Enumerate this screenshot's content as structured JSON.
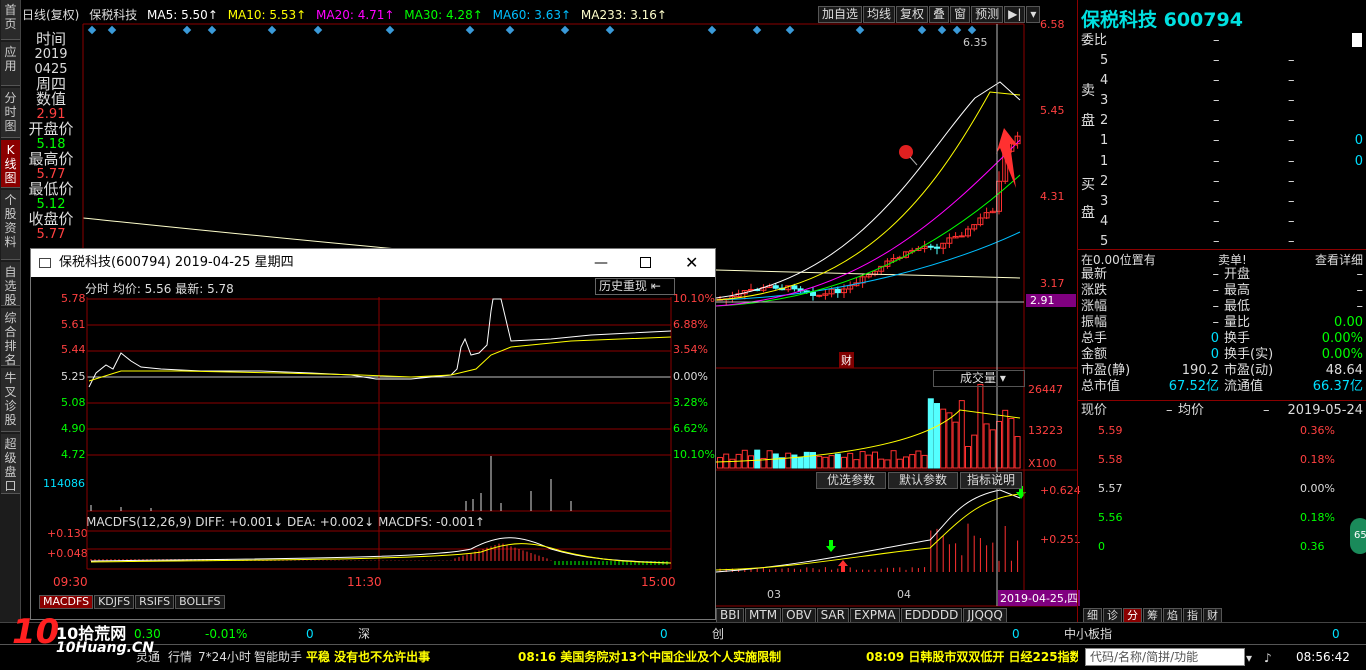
{
  "vtabs": [
    "首页",
    "应用",
    "分时图",
    "K线图",
    "个股资料",
    "自选股",
    "综合排名",
    "牛叉诊股",
    "超级盘口"
  ],
  "topbar": {
    "period": "日线(复权)",
    "stock": "保税科技",
    "ma5": "MA5: 5.50↑",
    "ma10": "MA10: 5.53↑",
    "ma20": "MA20: 4.71↑",
    "ma30": "MA30: 4.28↑",
    "ma60": "MA60: 3.63↑",
    "ma233": "MA233: 3.16↑"
  },
  "ctrl": [
    "加自选",
    "均线",
    "复权",
    "叠",
    "窗",
    "预测"
  ],
  "info": {
    "l1": "时间",
    "l2": "2019",
    "l3": "0425",
    "l4": "周四",
    "l5": "数值",
    "v5": "2.91",
    "l6": "开盘价",
    "v6": "5.18",
    "l7": "最高价",
    "v7": "5.77",
    "l8": "最低价",
    "v8": "5.12",
    "l9": "收盘价",
    "v9": "5.77"
  },
  "prices": {
    "p1": "6.58",
    "p2": "5.45",
    "p3": "4.31",
    "p4": "3.17",
    "p5": "2.91",
    "hi": "6.35"
  },
  "vol": {
    "label": "成交量",
    "v1": "26447",
    "v2": "13223",
    "v3": "X100"
  },
  "params": [
    "优选参数",
    "默认参数",
    "指标说明"
  ],
  "macd": {
    "m1": "0.624",
    "m2": "0.251"
  },
  "months": {
    "m3": "03",
    "m4": "04",
    "date": "2019-04-25,四",
    "cai": "财"
  },
  "itabs": [
    "BBI",
    "MTM",
    "OBV",
    "SAR",
    "EXPMA",
    "EDDDDD",
    "JJQQQ"
  ],
  "rp": {
    "title": "保税科技 600794",
    "weibi": "委比",
    "dash": "–",
    "mai": "卖",
    "pan": "盘",
    "buy": "买",
    "zero": "0",
    "atzero": "在0.00位置有",
    "maidan": "卖单!",
    "detail": "查看详细",
    "s": [
      "5",
      "4",
      "3",
      "2",
      "1"
    ],
    "b": [
      "1",
      "2",
      "3",
      "4",
      "5"
    ],
    "k1": "最新",
    "k2": "开盘",
    "k3": "涨跌",
    "k4": "最高",
    "k5": "涨幅",
    "k6": "最低",
    "k7": "振幅",
    "k8": "量比",
    "k9": "总手",
    "k10": "换手",
    "k11": "金额",
    "k12": "换手(实)",
    "k13": "市盈(静)",
    "k14": "市盈(动)",
    "k15": "总市值",
    "k16": "流通值",
    "v8": "0.00",
    "v10": "0.00%",
    "v12": "0.00%",
    "v13": "190.2",
    "v14": "48.64",
    "v15": "67.52亿",
    "v16": "66.37亿",
    "cur": "现价",
    "avg": "均价",
    "dt": "2019-05-24",
    "px": [
      "5.59",
      "5.58",
      "5.57",
      "5.56",
      "0"
    ],
    "pc": [
      "0.36%",
      "0.18%",
      "0.00%",
      "0.18%",
      "0.36"
    ],
    "tabs": [
      "细",
      "诊",
      "分",
      "筹",
      "焰",
      "指",
      "财"
    ]
  },
  "popup": {
    "title": "保税科技(600794) 2019-04-25 星期四",
    "sub": "分时 均价: 5.56 最新: 5.78",
    "replay": "历史重现",
    "yl": [
      "5.78",
      "5.61",
      "5.44",
      "5.25",
      "5.08",
      "4.90",
      "4.72"
    ],
    "yr": [
      "10.10%",
      "6.88%",
      "3.54%",
      "0.00%",
      "3.28%",
      "6.62%",
      "10.10%"
    ],
    "volv": "114086",
    "macdtxt": "MACDFS(12,26,9) DIFF: +0.001↓ DEA: +0.002↓ MACDFS: -0.001↑",
    "m1": "+0.130",
    "m2": "+0.048",
    "t1": "09:30",
    "t2": "11:30",
    "t3": "15:00",
    "tabs": [
      "MACDFS",
      "KDJFS",
      "RSIFS",
      "BOLLFS"
    ]
  },
  "bottom": {
    "r1": "0.30",
    "r2": "-0.01%",
    "r3": "0",
    "sh": "深",
    "r4": "0",
    "cy": "创",
    "r5": "0",
    "small": "中小板指",
    "r6": "0",
    "b1": "灵通",
    "b2": "行情",
    "b3": "7*24小时",
    "b4": "智能助手",
    "n1": "平稳 没有也不允许出事",
    "n2": "08:16 美国务院对13个中国企业及个人实施限制",
    "n3": "08:09 日韩股市双双低开 日经225指数",
    "search": "代码/名称/简拼/功能",
    "time": "08:56:42",
    "logo": "10拾荒网",
    "logo2": "10Huang.CN"
  }
}
